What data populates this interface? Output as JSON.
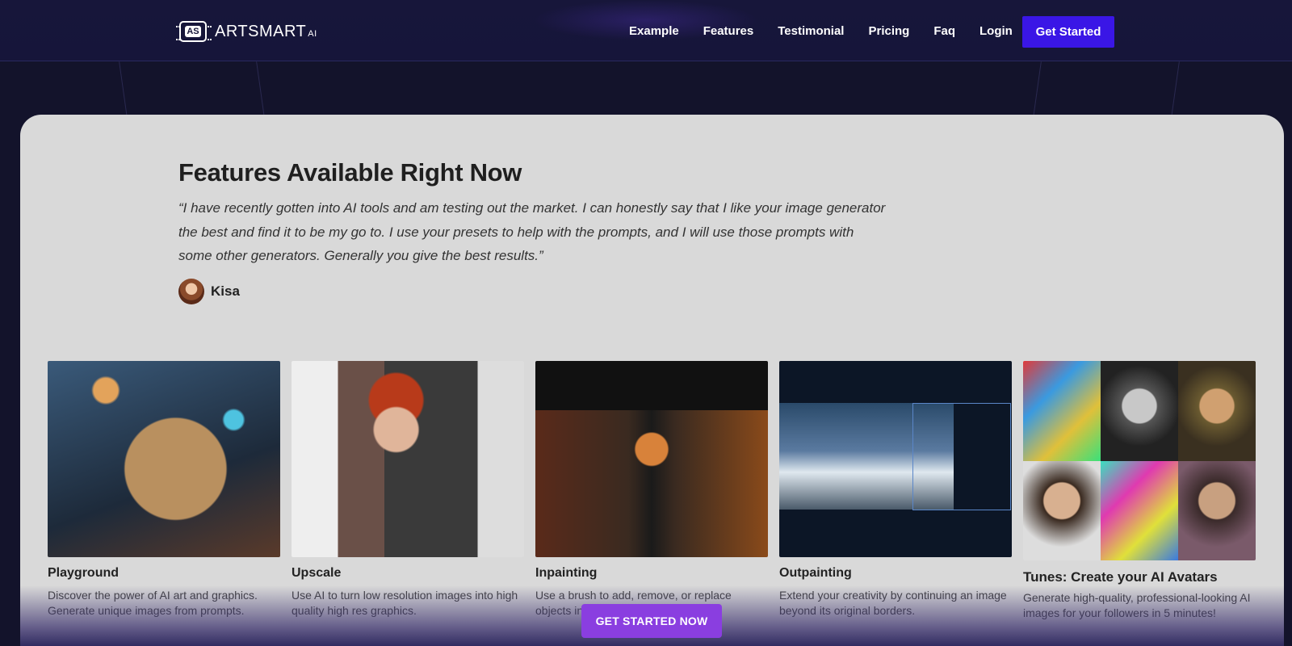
{
  "brand": {
    "logo_mark": "AS",
    "name": "ARTSMART",
    "suffix": "AI"
  },
  "nav": {
    "items": [
      "Example",
      "Features",
      "Testimonial",
      "Pricing",
      "Faq",
      "Login"
    ],
    "cta": "Get Started"
  },
  "section": {
    "heading": "Features Available Right Now",
    "quote": "“I have recently gotten into AI tools and am testing out the market. I can honestly say that I like your image generator the best and find it to be my go to. I use your presets to help with the prompts, and I will use those prompts with some other generators. Generally you give the best results.”",
    "author": "Kisa"
  },
  "cards": [
    {
      "title": "Playground",
      "desc": "Discover the power of AI art and graphics. Generate unique images from prompts."
    },
    {
      "title": "Upscale",
      "desc": "Use AI to turn low resolution images into high quality high res graphics."
    },
    {
      "title": "Inpainting",
      "desc": "Use a brush to add, remove, or replace objects in"
    },
    {
      "title": "Outpainting",
      "desc": "Extend your creativity by continuing an image beyond its original borders."
    },
    {
      "title": "Tunes: Create your AI Avatars",
      "desc": "Generate high-quality, professional-looking AI images for your followers in 5 minutes!"
    }
  ],
  "bottom_cta": "GET STARTED NOW",
  "colors": {
    "accent": "#3a16e6",
    "cta_purple": "#8a3ee0",
    "panel": "#d9d9d9",
    "bg": "#13132b"
  }
}
